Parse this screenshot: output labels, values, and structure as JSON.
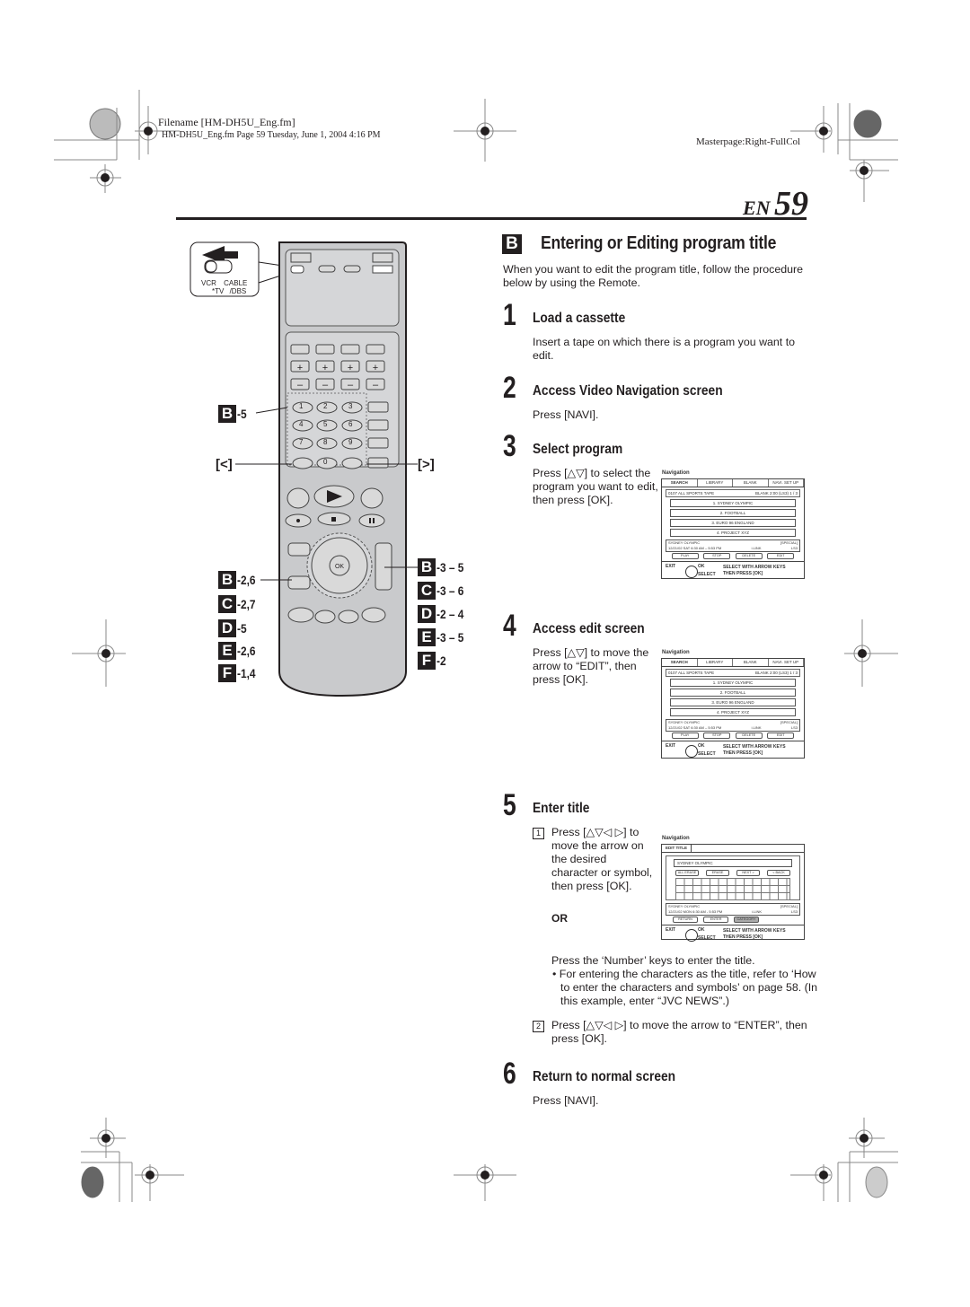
{
  "header": {
    "filename": "Filename [HM-DH5U_Eng.fm]",
    "fileinfo": "HM-DH5U_Eng.fm  Page 59  Tuesday, June 1, 2004  4:16 PM",
    "masterpage": "Masterpage:Right-FullCol",
    "page_lang": "EN",
    "page_number": "59"
  },
  "remote": {
    "switch_labels": {
      "vcr": "VCR",
      "tv": "*TV",
      "cable": "CABLE",
      "dbs": "/DBS"
    },
    "numpad": [
      "1",
      "2",
      "3",
      "4",
      "5",
      "6",
      "7",
      "8",
      "9",
      "0"
    ],
    "ok_label": "OK",
    "left_refs": [
      {
        "badge": "B",
        "text": "-5"
      },
      {
        "badge": "B",
        "text": "-2,6"
      },
      {
        "badge": "C",
        "text": "-2,7"
      },
      {
        "badge": "D",
        "text": "-5"
      },
      {
        "badge": "E",
        "text": "-2,6"
      },
      {
        "badge": "F",
        "text": "-1,4"
      }
    ],
    "right_refs": [
      {
        "badge": "B",
        "text": "-3 – 5"
      },
      {
        "badge": "C",
        "text": "-3 – 6"
      },
      {
        "badge": "D",
        "text": "-2 – 4"
      },
      {
        "badge": "E",
        "text": "-3 – 5"
      },
      {
        "badge": "F",
        "text": "-2"
      }
    ],
    "left_bracket": "[<]",
    "right_bracket": "[>]"
  },
  "section": {
    "badge": "B",
    "title": "Entering or Editing program title",
    "intro": "When you want to edit the program title, follow the procedure below by using the Remote."
  },
  "steps": [
    {
      "num": "1",
      "title": "Load a cassette",
      "body": "Insert a tape on which there is a program you want to edit."
    },
    {
      "num": "2",
      "title": "Access Video Navigation screen",
      "body": "Press [NAVI]."
    },
    {
      "num": "3",
      "title": "Select program",
      "body": "Press [△▽] to select the program you want to edit, then press [OK]."
    },
    {
      "num": "4",
      "title": "Access edit screen",
      "body": "Press [△▽] to move the arrow to “EDIT”, then press [OK]."
    },
    {
      "num": "5",
      "title": "Enter title",
      "sub1_num": "1",
      "sub1": "Press [△▽◁ ▷] to move the arrow on the desired character or symbol, then press [OK].",
      "or": "OR",
      "alt": "Press the ‘Number’ keys to enter the title.",
      "bullet": "For entering the characters as the title, refer to ‘How to enter the characters and symbols’ on page 58. (In this example, enter “JVC NEWS”.)",
      "sub2_num": "2",
      "sub2": "Press [△▽◁ ▷] to move the arrow to “ENTER”, then press [OK]."
    },
    {
      "num": "6",
      "title": "Return to normal screen",
      "body": "Press [NAVI]."
    }
  ],
  "nav_screen": {
    "label": "Navigation",
    "tabs": [
      "SEARCH",
      "LIBRARY",
      "BLANK",
      "NAVI. SET UP"
    ],
    "tape_info": "0107 ALL SPORTS TAPE",
    "blank_info": "BLANK 2:00 (LS3)   1 / 3",
    "items": [
      "1. SYDNEY OLYMPIC",
      "2. FOOTBALL",
      "3. EURO 96 ENGLAND",
      "4. PROJECT XYZ"
    ],
    "detail_title": "SYDNEY OLYMPIC",
    "detail_time": "12/21/02 SAT  6:30 AM – 5:53 PM",
    "detail_link": "i.LINK",
    "detail_mode": "[SPECIAL]",
    "detail_speed": "LS3",
    "buttons": [
      "PLAY",
      "STOP",
      "DELETE",
      "EDIT"
    ],
    "exit": "EXIT",
    "ok": "OK",
    "select": "SELECT",
    "hint1": "SELECT WITH ARROW KEYS",
    "hint2": "THEN PRESS [OK]"
  },
  "edit_screen": {
    "label": "Navigation",
    "tab": "EDIT TITLE",
    "title_value": "SYDNEY OLYMPIC",
    "buttons": [
      "ALL ERASE",
      "ERASE",
      "NEXT >",
      "< BACK"
    ],
    "detail_title": "SYDNEY OLYMPIC",
    "detail_time": "12/21/02 MON  6:30 AM - 5:53 PM",
    "detail_link": "i.LINK",
    "detail_mode": "[SPECIAL]",
    "detail_speed": "LS3",
    "bottom_buttons": [
      "RETURN",
      "ENTER",
      "CATEGORY"
    ]
  }
}
